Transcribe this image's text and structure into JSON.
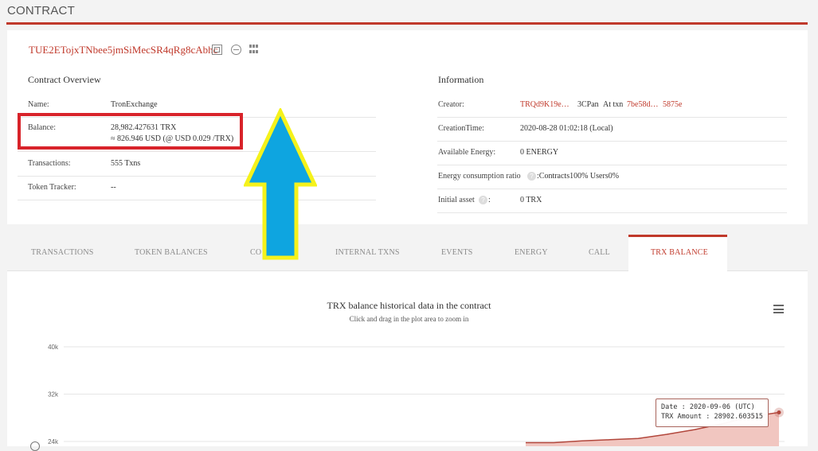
{
  "page": {
    "title": "CONTRACT"
  },
  "contract": {
    "address": "TUE2ETojxTNbee5jmSiMecSR4qRg8cAbhc"
  },
  "overview": {
    "title": "Contract Overview",
    "rows": [
      {
        "label": "Name:",
        "value": "TronExchange"
      },
      {
        "label": "Balance:",
        "value": "28,982.427631 TRX",
        "value2": "≈ 826.946 USD (@ USD 0.029 /TRX)"
      },
      {
        "label": "Transactions:",
        "value": "555  Txns"
      },
      {
        "label": "Token Tracker:",
        "value": "--"
      }
    ]
  },
  "information": {
    "title": "Information",
    "creator_label": "Creator:",
    "creator_addr": "TRQd9K19e…",
    "creator_mid": "3CPan",
    "creator_at": "At txn",
    "creator_txn": "7be58d…",
    "creator_txn_tail": "5875e",
    "creation_label": "CreationTime:",
    "creation_value": "2020-08-28 01:02:18 (Local)",
    "energy_label": "Available Energy:",
    "energy_value": "0  ENERGY",
    "ratio_label": "Energy consumption ratio",
    "ratio_value": ":Contracts100%   Users0%",
    "asset_label": "Initial asset",
    "asset_value": "0 TRX",
    "help_glyph": "?",
    "colon": ":"
  },
  "tabs": [
    {
      "label": "TRANSACTIONS"
    },
    {
      "label": "TOKEN BALANCES"
    },
    {
      "label": "CO"
    },
    {
      "label": "INTERNAL TXNS"
    },
    {
      "label": "EVENTS"
    },
    {
      "label": "ENERGY"
    },
    {
      "label": "CALL"
    },
    {
      "label": "TRX BALANCE"
    }
  ],
  "colors": {
    "accent": "#c0392b",
    "highlight": "#d8232a",
    "arrow_fill": "#0ea5e0",
    "arrow_border": "#f5f21b"
  },
  "chart_data": {
    "type": "area",
    "title": "TRX balance historical data in the contract",
    "subtitle": "Click and drag in the plot area to zoom in",
    "xlabel": "",
    "ylabel": "",
    "y_ticks": [
      "40k",
      "32k",
      "24k"
    ],
    "ylim": [
      24000,
      40000
    ],
    "grid": true,
    "legend": "none",
    "series": [
      {
        "values": [
          {
            "x": "2020-08-28",
            "y": 23800
          },
          {
            "x": "2020-08-29",
            "y": 23800
          },
          {
            "x": "2020-08-30",
            "y": 24100
          },
          {
            "x": "2020-08-31",
            "y": 24300
          },
          {
            "x": "2020-09-01",
            "y": 24500
          },
          {
            "x": "2020-09-02",
            "y": 25200
          },
          {
            "x": "2020-09-03",
            "y": 26000
          },
          {
            "x": "2020-09-04",
            "y": 27000
          },
          {
            "x": "2020-09-05",
            "y": 28200
          },
          {
            "x": "2020-09-06",
            "y": 28902.603515
          }
        ]
      }
    ],
    "tooltip": {
      "date_line": "Date : 2020-09-06 (UTC)",
      "amount_line": "TRX Amount : 28902.603515"
    }
  }
}
